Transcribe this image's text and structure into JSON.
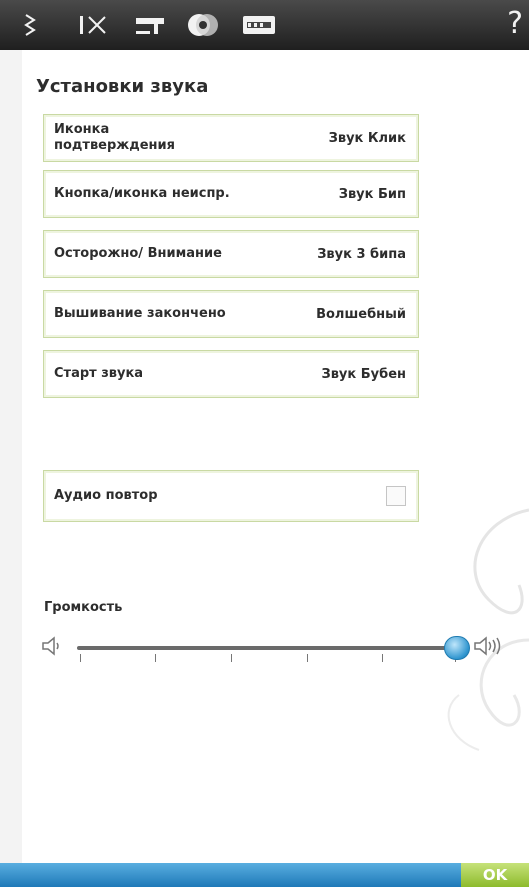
{
  "toolbar": {
    "icons": [
      "stitch-menu-icon",
      "scissors-icon",
      "sewing-machine-icon",
      "bobbin-icon",
      "hoop-settings-icon"
    ],
    "help_label": "?"
  },
  "page": {
    "title": "Установки звука"
  },
  "sound_settings": [
    {
      "label": "Иконка подтверждения",
      "value": "Звук Клик"
    },
    {
      "label": "Кнопка/иконка неиспр.",
      "value": "Звук Бип"
    },
    {
      "label": "Осторожно/ Внимание",
      "value": "Звук 3 бипа"
    },
    {
      "label": "Вышивание закончено",
      "value": "Волшебный"
    },
    {
      "label": "Старт звука",
      "value": "Звук Бубен"
    }
  ],
  "audio_repeat": {
    "label": "Аудио повтор",
    "checked": false
  },
  "volume": {
    "label": "Громкость",
    "level": 1.0,
    "ticks": 6
  },
  "bottom": {
    "ok_label": "OK"
  },
  "colors": {
    "topbar": "#2e2e2e",
    "row_border": "#c9d9a3",
    "slider_knob": "#2f95cf",
    "ok_button": "#9cc63a",
    "bottom_bar": "#2f8dcb"
  }
}
